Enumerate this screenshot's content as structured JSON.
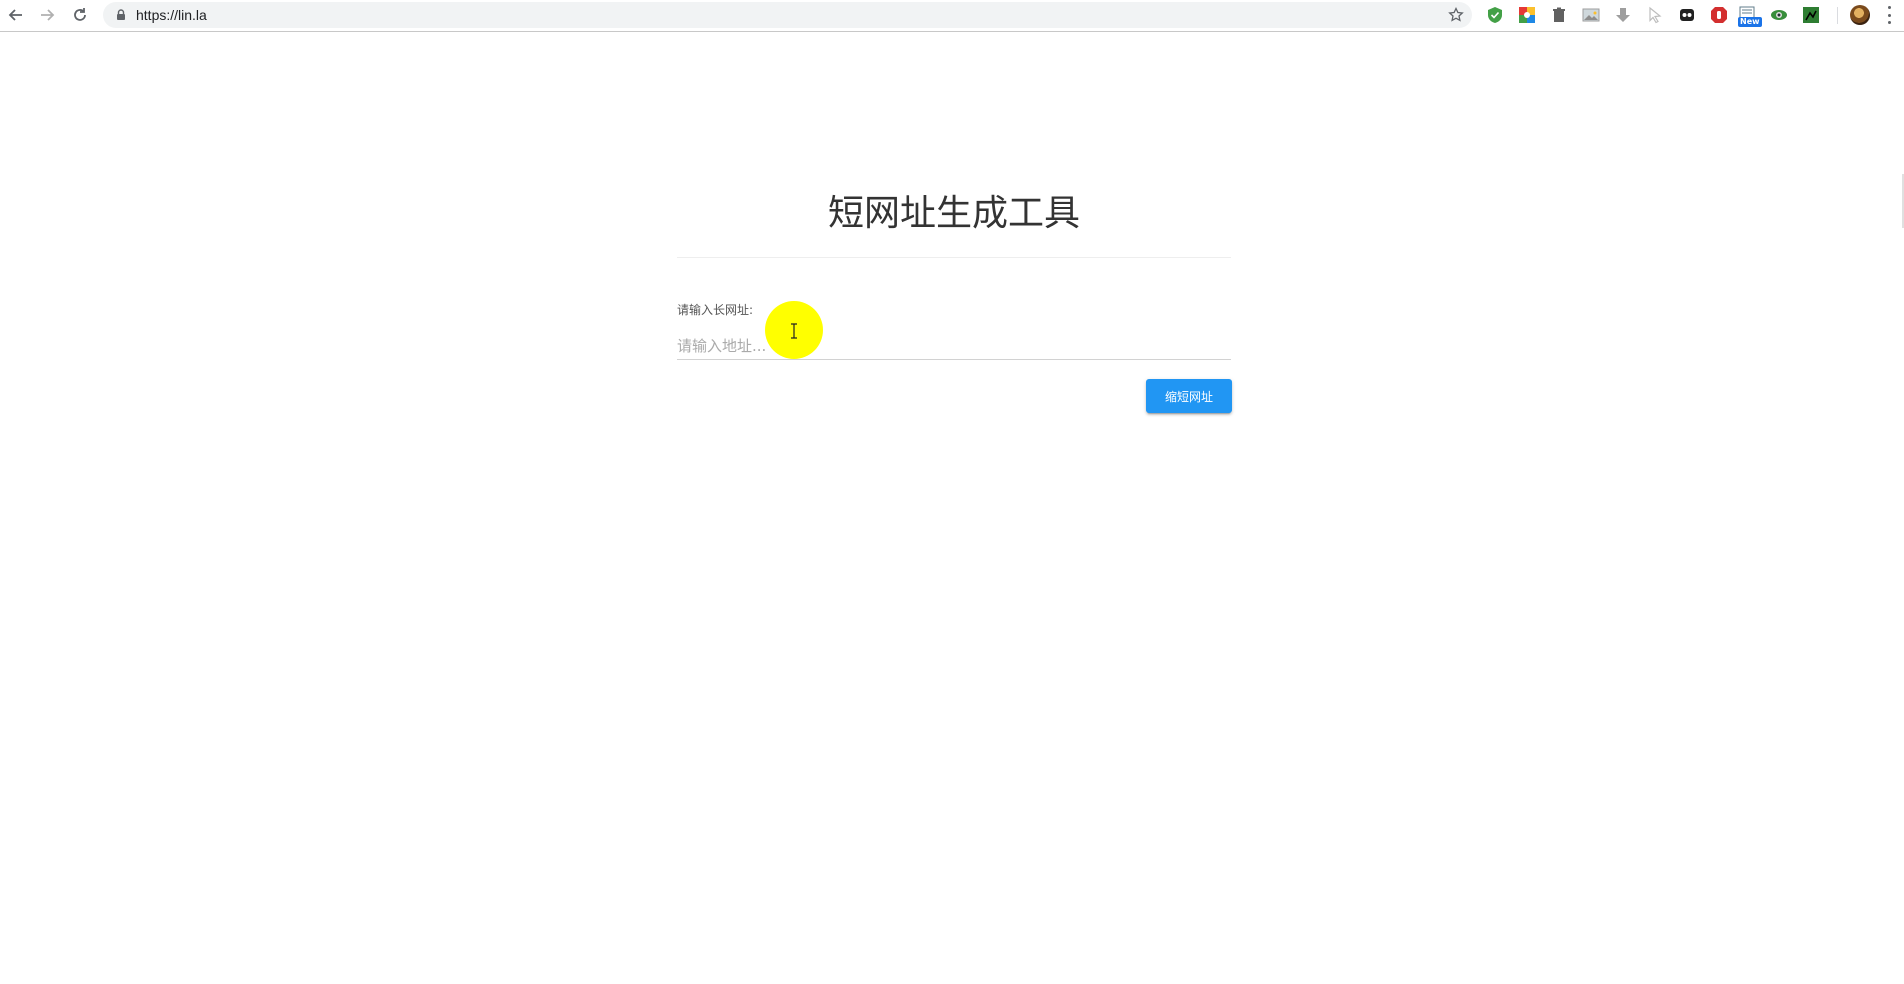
{
  "browser": {
    "url": "https://lin.la",
    "extensions": [
      {
        "icon": "shield-check-icon",
        "color": "#43a047"
      },
      {
        "icon": "chrome-grid-icon",
        "color": "#e53935"
      },
      {
        "icon": "trash-icon",
        "color": "#616161"
      },
      {
        "icon": "image-icon",
        "color": "#9e9e9e"
      },
      {
        "icon": "download-arrow-icon",
        "color": "#9e9e9e"
      },
      {
        "icon": "cursor-icon",
        "color": "#bdbdbd"
      },
      {
        "icon": "ghost-icon",
        "color": "#212121"
      },
      {
        "icon": "stop-hand-icon",
        "color": "#d32f2f"
      },
      {
        "icon": "new-badge-ext-icon",
        "color": "#1a73e8"
      },
      {
        "icon": "eye-ext-icon",
        "color": "#388e3c"
      },
      {
        "icon": "green-ext-icon",
        "color": "#2e7d32"
      }
    ],
    "new_badge": "New"
  },
  "page": {
    "title": "短网址生成工具",
    "label": "请输入长网址:",
    "input_placeholder": "请输入地址...",
    "input_value": "",
    "button_label": "缩短网址",
    "accent_color": "#2196f3"
  }
}
